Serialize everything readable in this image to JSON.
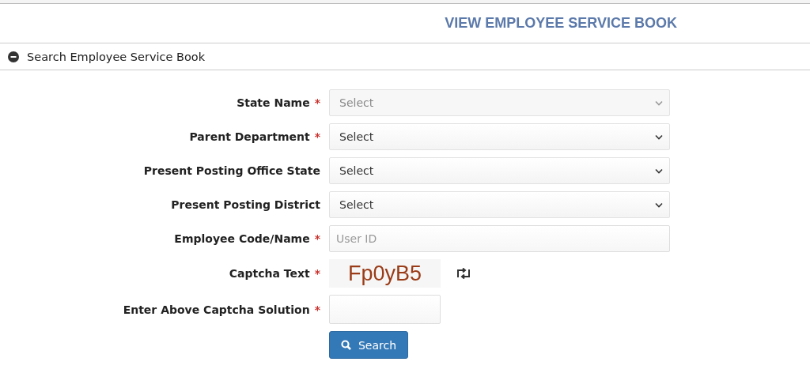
{
  "page_title": "VIEW EMPLOYEE SERVICE BOOK",
  "section": {
    "title": "Search Employee Service Book",
    "expanded": true
  },
  "required_mark": "*",
  "fields": [
    {
      "kind": "select",
      "label": "State Name",
      "required": true,
      "value": "Select",
      "disabled": true
    },
    {
      "kind": "select",
      "label": "Parent Department",
      "required": true,
      "value": "Select",
      "disabled": false
    },
    {
      "kind": "select",
      "label": "Present Posting Office State",
      "required": false,
      "value": "Select",
      "disabled": false
    },
    {
      "kind": "select",
      "label": "Present Posting District",
      "required": false,
      "value": "Select",
      "disabled": false
    },
    {
      "kind": "text",
      "label": "Employee Code/Name",
      "required": true,
      "placeholder": "User ID"
    },
    {
      "kind": "captcha",
      "label": "Captcha Text",
      "required": true,
      "captcha": "Fp0yB5"
    },
    {
      "kind": "answer",
      "label": "Enter Above Captcha Solution",
      "required": true
    }
  ],
  "search_button": {
    "label": "Search"
  }
}
